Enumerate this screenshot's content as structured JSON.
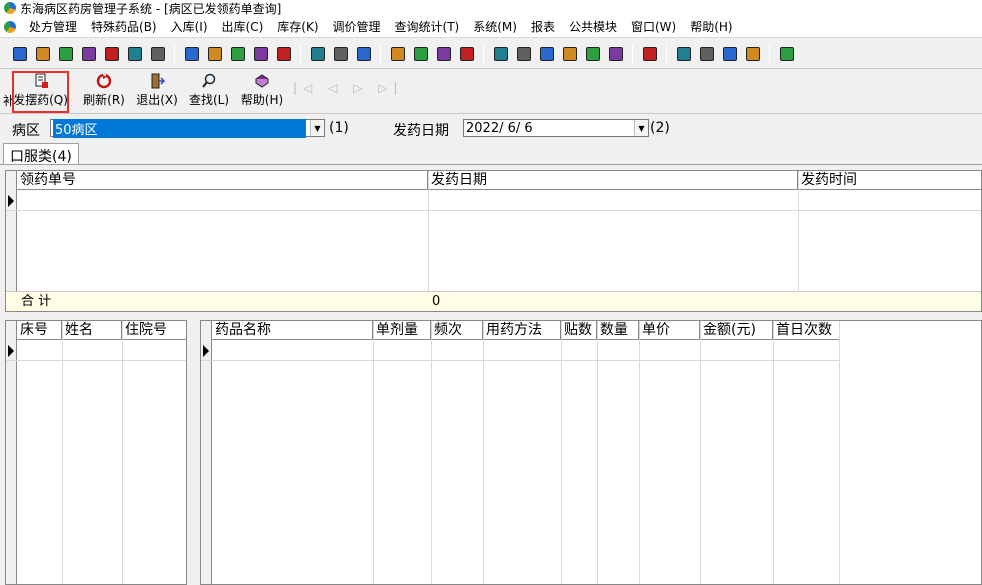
{
  "window": {
    "title": "东海病区药房管理子系统 - [病区已发领药单查询]"
  },
  "menu": [
    "处方管理",
    "特殊药品(B)",
    "入库(I)",
    "出库(C)",
    "库存(K)",
    "调价管理",
    "查询统计(T)",
    "系统(M)",
    "报表",
    "公共模块",
    "窗口(W)",
    "帮助(H)"
  ],
  "toolbar_icons": [
    "printer-icon",
    "bottle-icon",
    "check-icon",
    "report-icon",
    "binoculars-icon",
    "lab-icon",
    "cut-icon",
    "folder-icon",
    "clipboard-icon",
    "checkmark-icon",
    "document-icon",
    "export-icon",
    "chart-icon",
    "calculator-icon",
    "grid-icon",
    "bell-icon",
    "warning-icon",
    "trash-icon",
    "user-icon",
    "person-icon",
    "drawer-icon",
    "thermometer-icon",
    "search-icon",
    "close-icon",
    "folder-open-icon",
    "hexagon-icon",
    "zoom-icon",
    "list-icon",
    "tree-icon",
    "arrow-icon",
    "exit-icon"
  ],
  "toolbar2": {
    "clip_label": "补",
    "buttons": [
      {
        "label": "发摆药(Q)",
        "icon": "dispense-icon"
      },
      {
        "label": "刷新(R)",
        "icon": "refresh-icon"
      },
      {
        "label": "退出(X)",
        "icon": "exit-icon"
      },
      {
        "label": "查找(L)",
        "icon": "search-icon"
      },
      {
        "label": "帮助(H)",
        "icon": "help-book-icon"
      }
    ],
    "nav": "|◁ ◁ ▷ ▷|"
  },
  "filter": {
    "ward_label": "病区",
    "ward_value": "50病区",
    "ward_hotkey": "(1)",
    "date_label": "发药日期",
    "date_value": "2022/ 6/ 6",
    "date_hotkey": "(2)"
  },
  "tab": {
    "label": "口服类(4)"
  },
  "top_grid": {
    "columns": [
      "领药单号",
      "发药日期",
      "发药时间"
    ],
    "total_label": "合  计",
    "total_value": "0"
  },
  "patient_grid": {
    "columns": [
      "床号",
      "姓名",
      "住院号"
    ]
  },
  "drug_grid": {
    "columns": [
      "药品名称",
      "单剂量",
      "频次",
      "用药方法",
      "贴数",
      "数量",
      "单价",
      "金额(元)",
      "首日次数"
    ]
  }
}
